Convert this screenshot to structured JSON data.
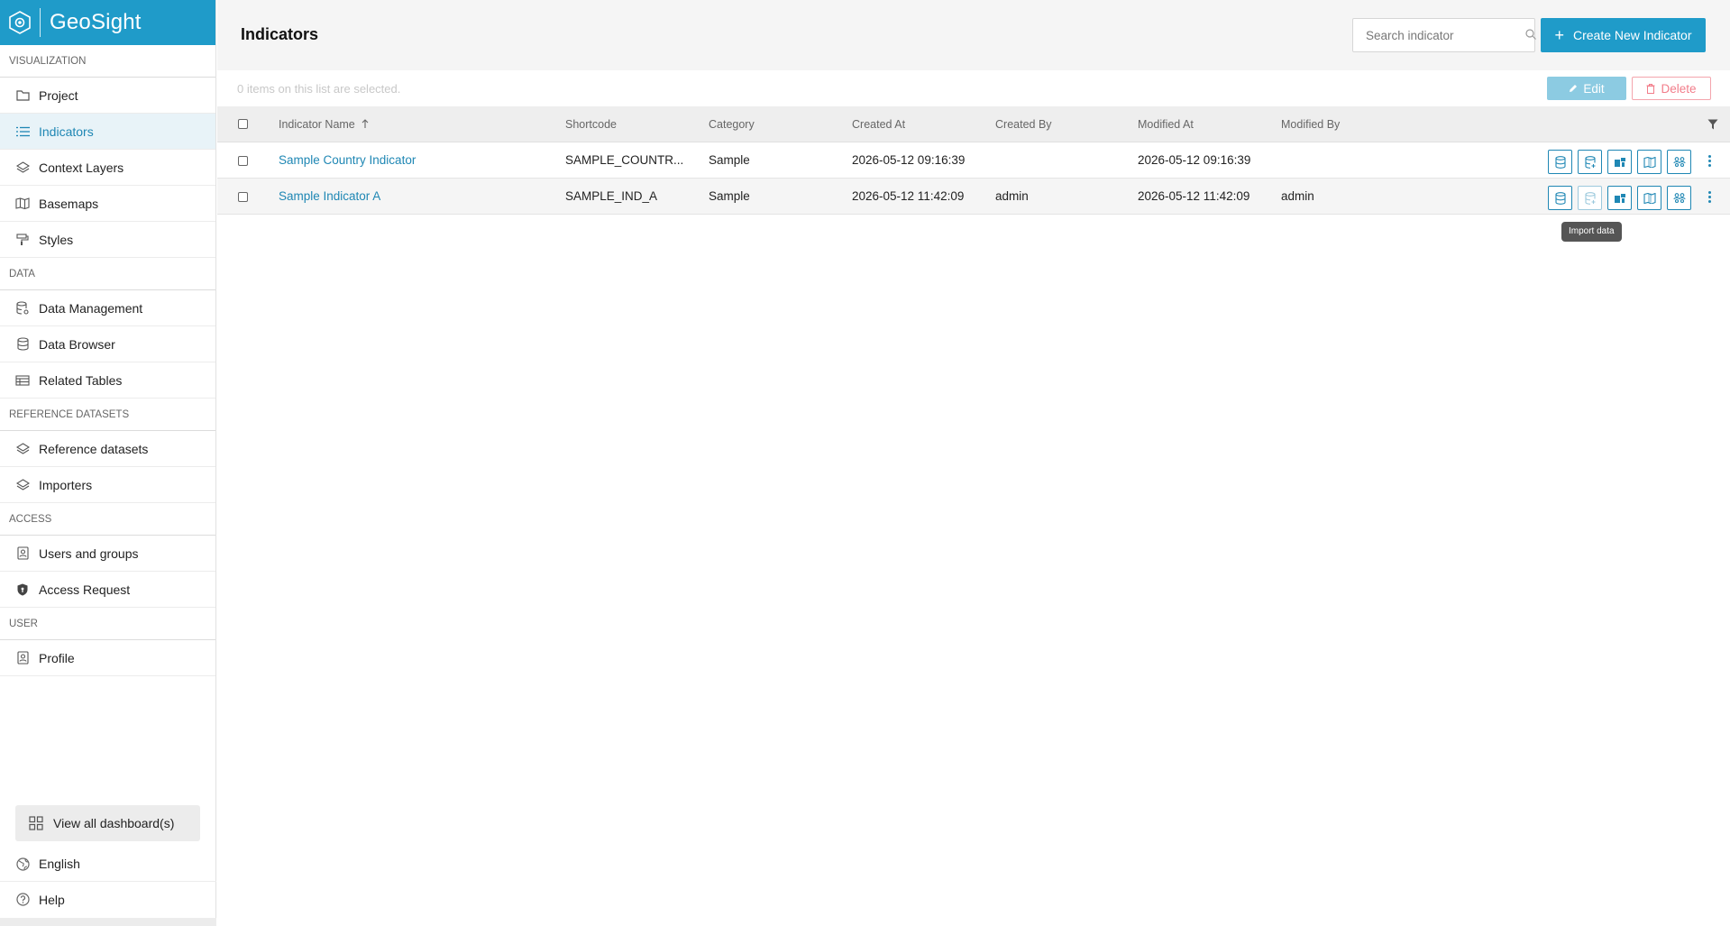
{
  "brand": {
    "name": "GeoSight",
    "color": "#1f9bc9"
  },
  "sidebar": {
    "sections": [
      {
        "title": "VISUALIZATION",
        "items": [
          {
            "label": "Project",
            "icon": "folder-icon",
            "active": false
          },
          {
            "label": "Indicators",
            "icon": "list-icon",
            "active": true
          },
          {
            "label": "Context Layers",
            "icon": "layers-icon",
            "active": false
          },
          {
            "label": "Basemaps",
            "icon": "map-icon",
            "active": false
          },
          {
            "label": "Styles",
            "icon": "paint-roller-icon",
            "active": false
          }
        ]
      },
      {
        "title": "DATA",
        "items": [
          {
            "label": "Data Management",
            "icon": "database-gear-icon",
            "active": false
          },
          {
            "label": "Data Browser",
            "icon": "database-icon",
            "active": false
          },
          {
            "label": "Related Tables",
            "icon": "table-icon",
            "active": false
          }
        ]
      },
      {
        "title": "REFERENCE DATASETS",
        "items": [
          {
            "label": "Reference datasets",
            "icon": "layers-icon",
            "active": false
          },
          {
            "label": "Importers",
            "icon": "layers-icon",
            "active": false
          }
        ]
      },
      {
        "title": "ACCESS",
        "items": [
          {
            "label": "Users and groups",
            "icon": "user-card-icon",
            "active": false
          },
          {
            "label": "Access Request",
            "icon": "shield-icon",
            "active": false
          }
        ]
      },
      {
        "title": "USER",
        "items": [
          {
            "label": "Profile",
            "icon": "user-card-icon",
            "active": false
          }
        ]
      }
    ],
    "view_all": "View all dashboard(s)",
    "language": "English",
    "help": "Help"
  },
  "header": {
    "title": "Indicators",
    "search_placeholder": "Search indicator",
    "create_label": "Create New Indicator"
  },
  "selection": {
    "text": "0 items on this list are selected.",
    "edit_label": "Edit",
    "delete_label": "Delete"
  },
  "table": {
    "columns": [
      "Indicator Name",
      "Shortcode",
      "Category",
      "Created At",
      "Created By",
      "Modified At",
      "Modified By"
    ],
    "rows": [
      {
        "name": "Sample Country Indicator",
        "shortcode": "SAMPLE_COUNTR...",
        "category": "Sample",
        "created_at": "2026-05-12 09:16:39",
        "created_by": "",
        "modified_at": "2026-05-12 09:16:39",
        "modified_by": ""
      },
      {
        "name": "Sample Indicator A",
        "shortcode": "SAMPLE_IND_A",
        "category": "Sample",
        "created_at": "2026-05-12 11:42:09",
        "created_by": "admin",
        "modified_at": "2026-05-12 11:42:09",
        "modified_by": "admin"
      }
    ]
  },
  "tooltip": "Import data"
}
